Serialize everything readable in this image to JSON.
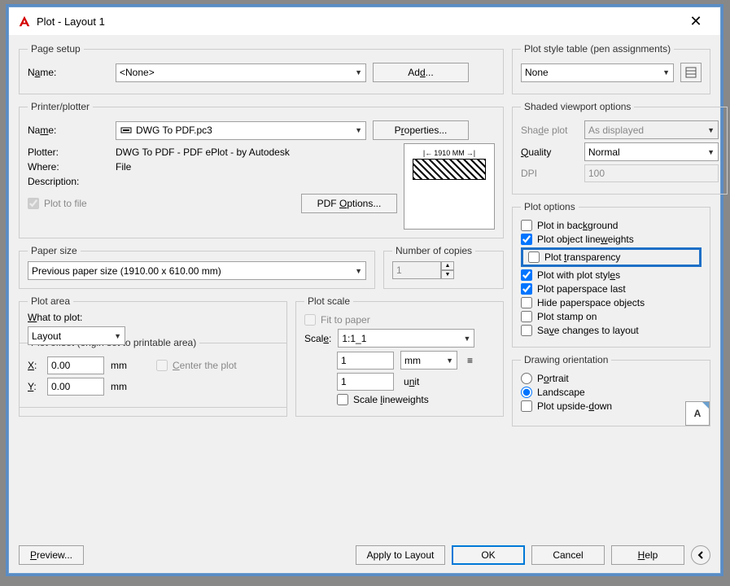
{
  "title": "Plot - Layout 1",
  "pageSetup": {
    "legend": "Page setup",
    "nameLabel": "Name:",
    "nameValue": "<None>",
    "addBtn": "Add..."
  },
  "printer": {
    "legend": "Printer/plotter",
    "nameLabel": "Name:",
    "nameValue": "DWG To PDF.pc3",
    "propertiesBtn": "Properties...",
    "plotterLabel": "Plotter:",
    "plotterValue": "DWG To PDF - PDF ePlot - by Autodesk",
    "whereLabel": "Where:",
    "whereValue": "File",
    "descLabel": "Description:",
    "plotToFile": "Plot to file",
    "pdfOptionsBtn": "PDF Options...",
    "previewDim": "1910 MM"
  },
  "paperSize": {
    "legend": "Paper size",
    "value": "Previous paper size  (1910.00 x 610.00 mm)"
  },
  "copies": {
    "legend": "Number of copies",
    "value": "1"
  },
  "plotArea": {
    "legend": "Plot area",
    "whatLabel": "What to plot:",
    "value": "Layout"
  },
  "plotScale": {
    "legend": "Plot scale",
    "fitLabel": "Fit to paper",
    "scaleLabel": "Scale:",
    "scaleValue": "1:1_1",
    "num1": "1",
    "unit1": "mm",
    "num2": "1",
    "unit2": "unit",
    "scaleLW": "Scale lineweights"
  },
  "plotOffset": {
    "legend": "Plot offset (origin set to printable area)",
    "xLabel": "X:",
    "xValue": "0.00",
    "xUnit": "mm",
    "yLabel": "Y:",
    "yValue": "0.00",
    "yUnit": "mm",
    "centerLabel": "Center the plot"
  },
  "plotStyle": {
    "legend": "Plot style table (pen assignments)",
    "value": "None"
  },
  "shaded": {
    "legend": "Shaded viewport options",
    "shadeLabel": "Shade plot",
    "shadeValue": "As displayed",
    "qualityLabel": "Quality",
    "qualityValue": "Normal",
    "dpiLabel": "DPI",
    "dpiValue": "100"
  },
  "plotOptions": {
    "legend": "Plot options",
    "bg": "Plot in background",
    "lw": "Plot object lineweights",
    "trans": "Plot transparency",
    "styles": "Plot with plot styles",
    "paperspace": "Plot paperspace last",
    "hide": "Hide paperspace objects",
    "stamp": "Plot stamp on",
    "save": "Save changes to layout"
  },
  "orientation": {
    "legend": "Drawing orientation",
    "portrait": "Portrait",
    "landscape": "Landscape",
    "upside": "Plot upside-down",
    "iconLetter": "A"
  },
  "footer": {
    "preview": "Preview...",
    "apply": "Apply to Layout",
    "ok": "OK",
    "cancel": "Cancel",
    "help": "Help"
  }
}
